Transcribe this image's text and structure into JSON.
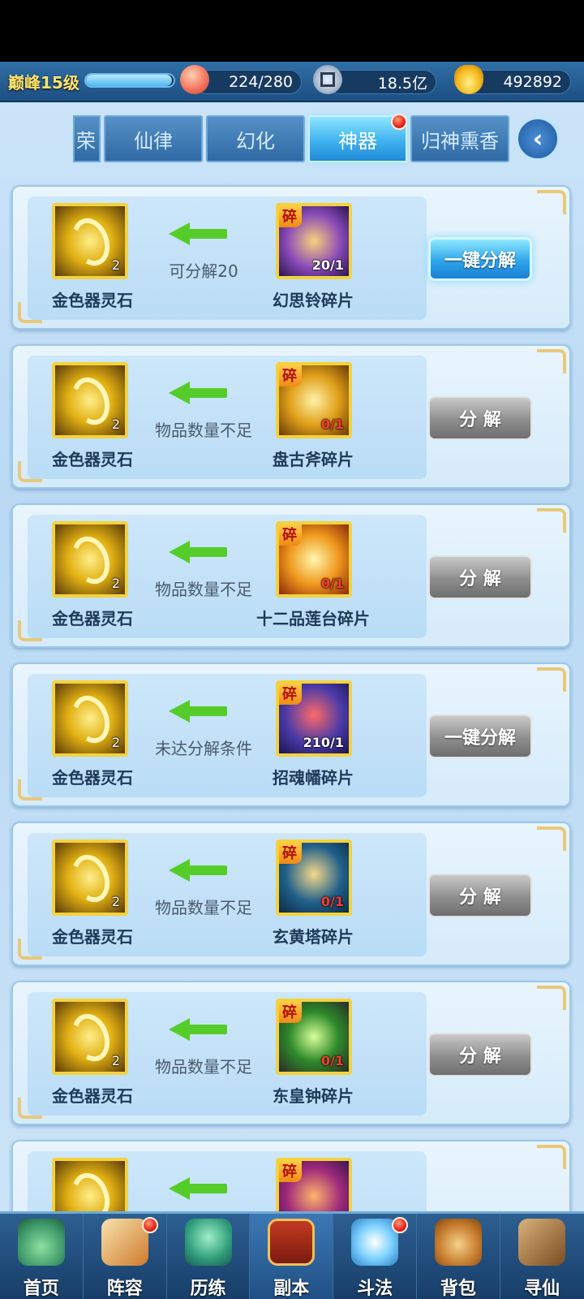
{
  "header": {
    "level_label": "巅峰15级",
    "exp_fraction": 0.98,
    "stamina": "224/280",
    "silver": "18.5亿",
    "gold": "492892",
    "icons": {
      "stamina": "peach-icon",
      "silver": "coin-icon",
      "gold": "ingot-icon"
    }
  },
  "tabs": {
    "partial": "荣",
    "items": [
      "仙律",
      "幻化",
      "神器",
      "归神熏香"
    ],
    "active": "神器",
    "back_icon": "back-arrow-icon"
  },
  "cards": [
    {
      "source_name": "金色器灵石",
      "source_count": "2",
      "status": "可分解20",
      "fragment_badge": "碎",
      "fragment_name": "幻思铃碎片",
      "fragment_count": "20/1",
      "button": "一键分解",
      "button_style": "blue"
    },
    {
      "source_name": "金色器灵石",
      "source_count": "2",
      "status": "物品数量不足",
      "fragment_badge": "碎",
      "fragment_name": "盘古斧碎片",
      "fragment_count": "0/1",
      "button": "分 解",
      "button_style": "gray"
    },
    {
      "source_name": "金色器灵石",
      "source_count": "2",
      "status": "物品数量不足",
      "fragment_badge": "碎",
      "fragment_name": "十二品莲台碎片",
      "fragment_count": "0/1",
      "button": "分 解",
      "button_style": "gray"
    },
    {
      "source_name": "金色器灵石",
      "source_count": "2",
      "status": "未达分解条件",
      "fragment_badge": "碎",
      "fragment_name": "招魂幡碎片",
      "fragment_count": "210/1",
      "button": "一键分解",
      "button_style": "gray"
    },
    {
      "source_name": "金色器灵石",
      "source_count": "2",
      "status": "物品数量不足",
      "fragment_badge": "碎",
      "fragment_name": "玄黄塔碎片",
      "fragment_count": "0/1",
      "button": "分 解",
      "button_style": "gray"
    },
    {
      "source_name": "金色器灵石",
      "source_count": "2",
      "status": "物品数量不足",
      "fragment_badge": "碎",
      "fragment_name": "东皇钟碎片",
      "fragment_count": "0/1",
      "button": "分 解",
      "button_style": "gray"
    },
    {
      "source_name": "",
      "source_count": "",
      "status": "",
      "fragment_badge": "碎",
      "fragment_name": "",
      "fragment_count": "",
      "button": "",
      "button_style": "gray"
    }
  ],
  "nav": {
    "items": [
      "首页",
      "阵容",
      "历练",
      "副本",
      "斗法",
      "背包",
      "寻仙"
    ],
    "active": "副本"
  },
  "colors": {
    "accent": "#3fb2ef",
    "tab_bg": "#2f6aa6",
    "arrow": "#56cc2a",
    "badge_red": "#e6231a",
    "gold_border": "#f4d23c"
  }
}
